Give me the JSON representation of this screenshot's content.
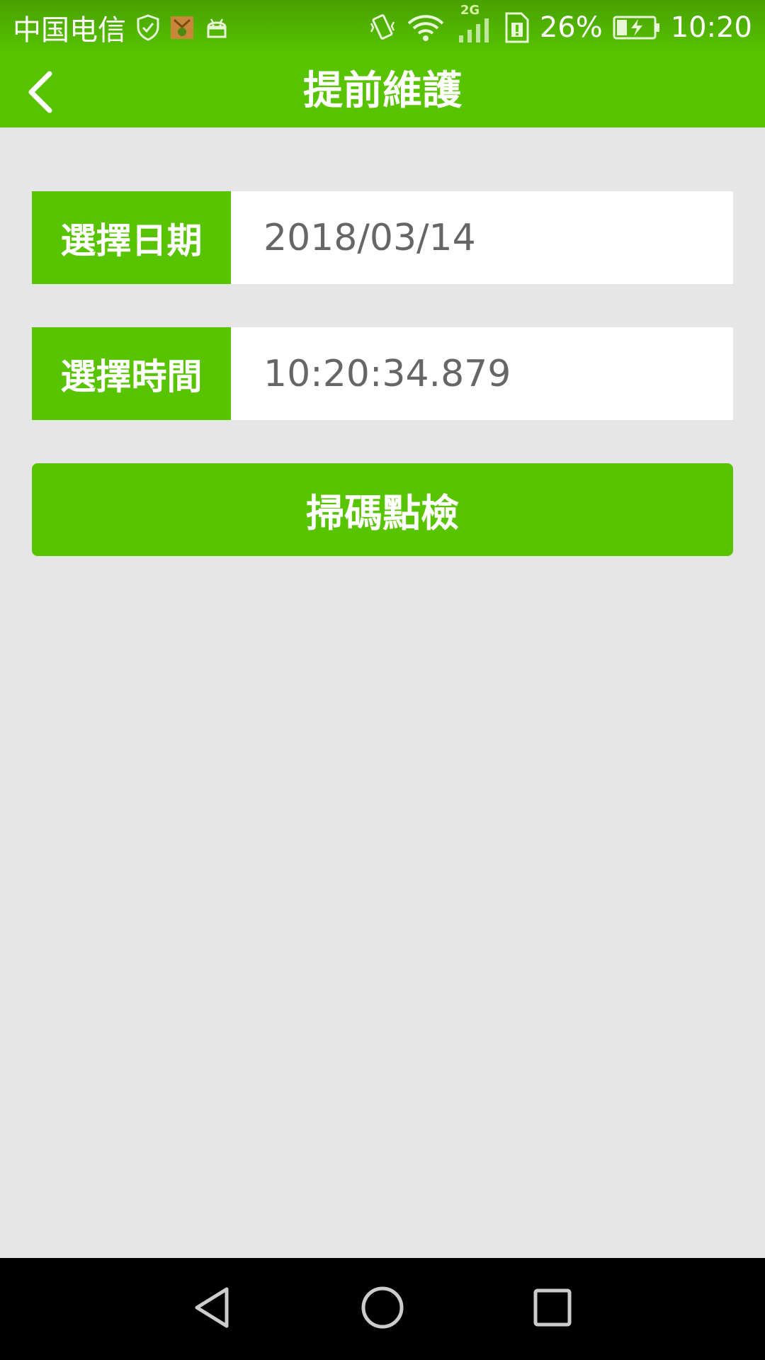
{
  "status_bar": {
    "carrier": "中国电信",
    "network_type": "2G",
    "battery_percent": "26%",
    "time": "10:20",
    "icons": [
      "shield-check-icon",
      "app-notification-icon",
      "android-icon",
      "vibrate-icon",
      "wifi-icon",
      "signal-icon",
      "sim-alert-icon",
      "battery-charging-icon"
    ]
  },
  "header": {
    "title": "提前維護",
    "back_icon": "chevron-left-icon"
  },
  "form": {
    "date_label": "選擇日期",
    "date_value": "2018/03/14",
    "time_label": "選擇時間",
    "time_value": "10:20:34.879"
  },
  "actions": {
    "scan_button_label": "掃碼點檢"
  },
  "colors": {
    "accent_green": "#58c400",
    "background": "#e6e6e6",
    "value_text": "#666666"
  },
  "nav_bar": {
    "icons": [
      "back-triangle-icon",
      "home-circle-icon",
      "recent-square-icon"
    ]
  }
}
